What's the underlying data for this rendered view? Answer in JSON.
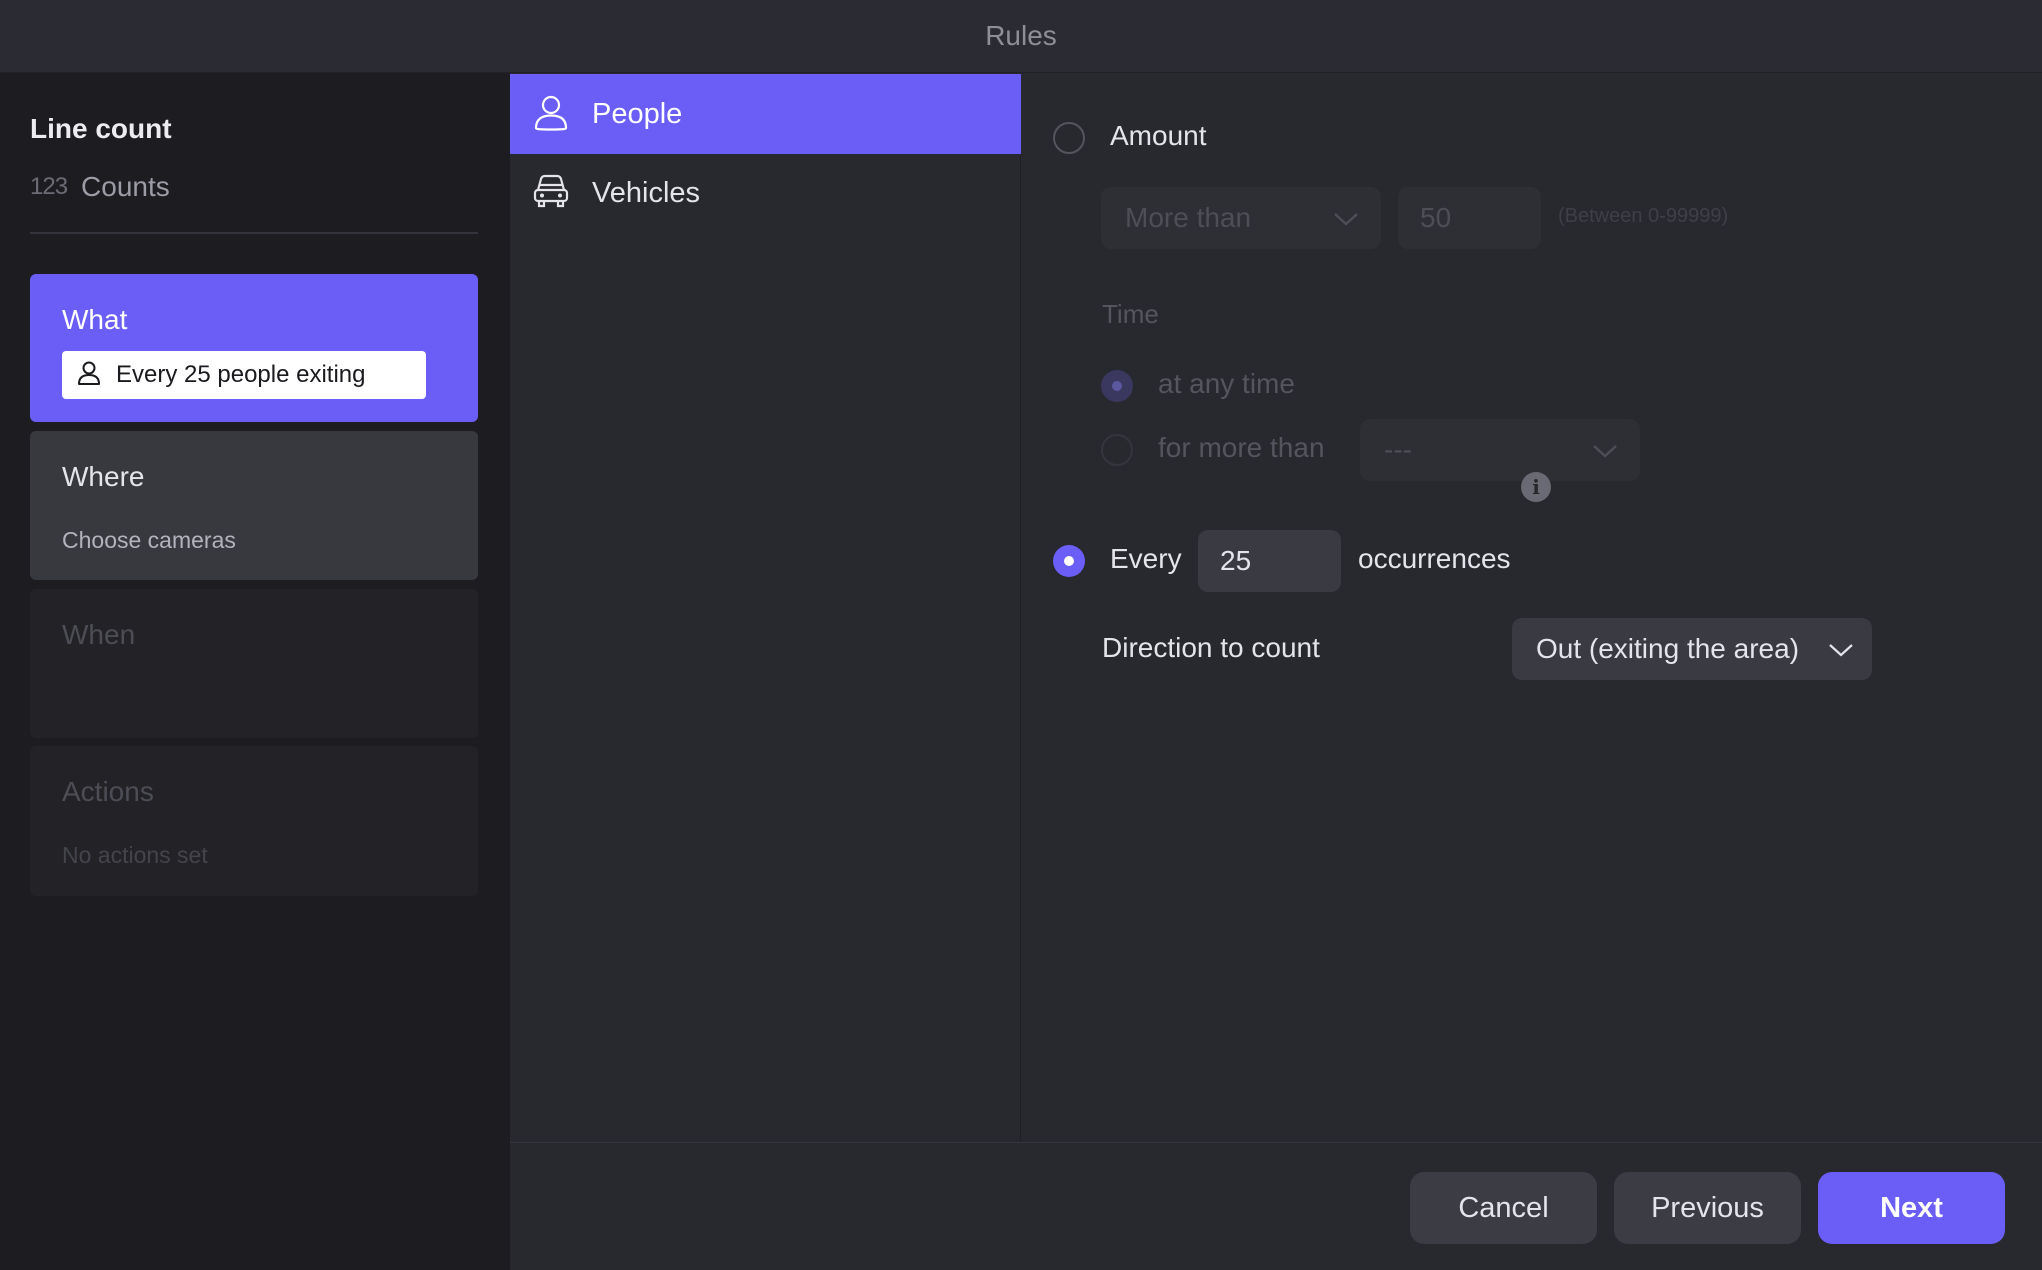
{
  "window": {
    "title": "Rules"
  },
  "sidebar": {
    "heading": "Line count",
    "counts_icon": "123",
    "counts_label": "Counts",
    "steps": {
      "what": {
        "title": "What",
        "chip_text": "Every 25 people exiting",
        "chip_icon": "person-icon"
      },
      "where": {
        "title": "Where",
        "subtitle": "Choose cameras"
      },
      "when": {
        "title": "When"
      },
      "actions": {
        "title": "Actions",
        "subtitle": "No actions set"
      }
    }
  },
  "objects": {
    "items": [
      {
        "label": "People",
        "icon": "person-icon",
        "selected": true
      },
      {
        "label": "Vehicles",
        "icon": "car-icon",
        "selected": false
      }
    ]
  },
  "settings": {
    "amount": {
      "label": "Amount",
      "selected": false,
      "comparator": "More than",
      "value": "50",
      "hint": "(Between 0-99999)"
    },
    "time": {
      "label": "Time",
      "any_time_label": "at any time",
      "more_than_label": "for more than",
      "duration_value": "---"
    },
    "every": {
      "label": "Every",
      "selected": true,
      "value": "25",
      "suffix": "occurrences",
      "info_icon": "i"
    },
    "direction": {
      "label": "Direction to count",
      "value": "Out (exiting the area)"
    }
  },
  "footer": {
    "cancel_label": "Cancel",
    "previous_label": "Previous",
    "next_label": "Next"
  },
  "colors": {
    "accent": "#6a5ef7",
    "background": "#28282f",
    "sidebar": "#1c1c21"
  }
}
